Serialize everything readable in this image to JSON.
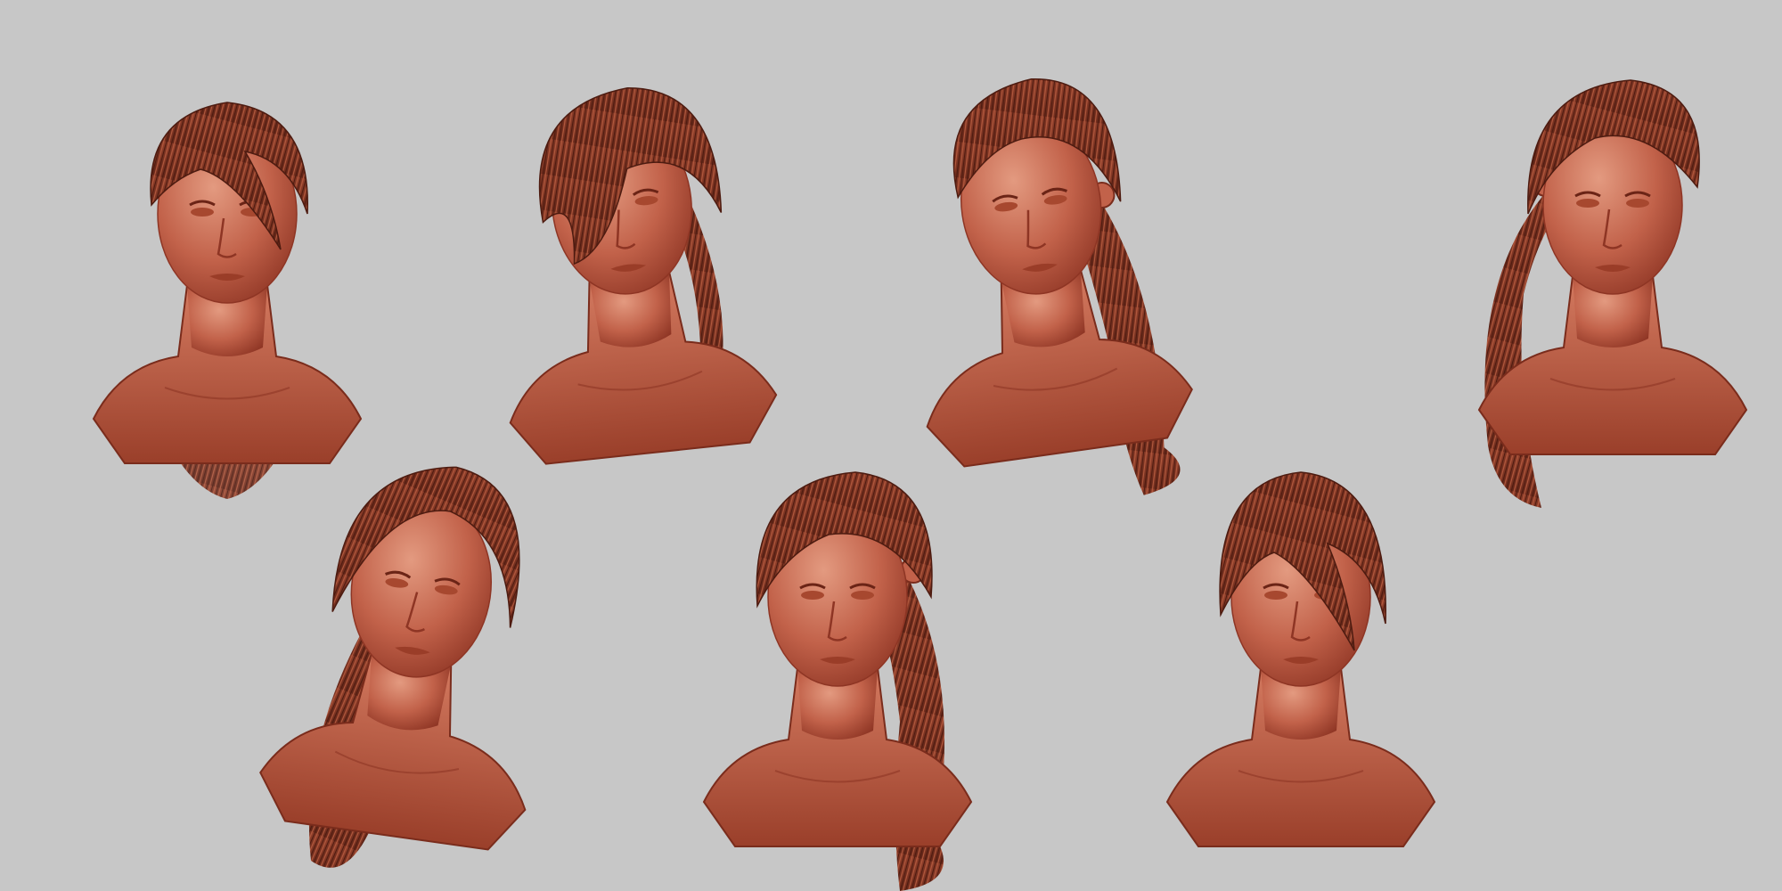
{
  "scene": {
    "background": "#c7c7c7",
    "material": {
      "skin_light": "#d9866e",
      "skin_mid": "#b8563d",
      "skin_dark": "#7a2c1c",
      "hair_mid": "#8a3a28",
      "hair_dark": "#5c2216",
      "hair_strand": "#a54c33"
    },
    "sculpts": [
      {
        "id": "bust-front",
        "view": "front",
        "hair": "loose-bangs"
      },
      {
        "id": "bust-three-quarter-down",
        "view": "three-quarter-left-looking-down",
        "hair": "side-swept"
      },
      {
        "id": "bust-three-quarter-up",
        "view": "three-quarter-left-looking-up",
        "hair": "ponytail"
      },
      {
        "id": "bust-profile-right",
        "view": "profile-right",
        "hair": "ponytail-with-tie"
      },
      {
        "id": "bust-tilted-up",
        "view": "three-quarter-tilted-up",
        "hair": "ponytail"
      },
      {
        "id": "bust-three-quarter-left",
        "view": "three-quarter-left",
        "hair": "ponytail-with-tie"
      },
      {
        "id": "bust-front-down",
        "view": "front-looking-down",
        "hair": "loose-bangs"
      }
    ]
  }
}
